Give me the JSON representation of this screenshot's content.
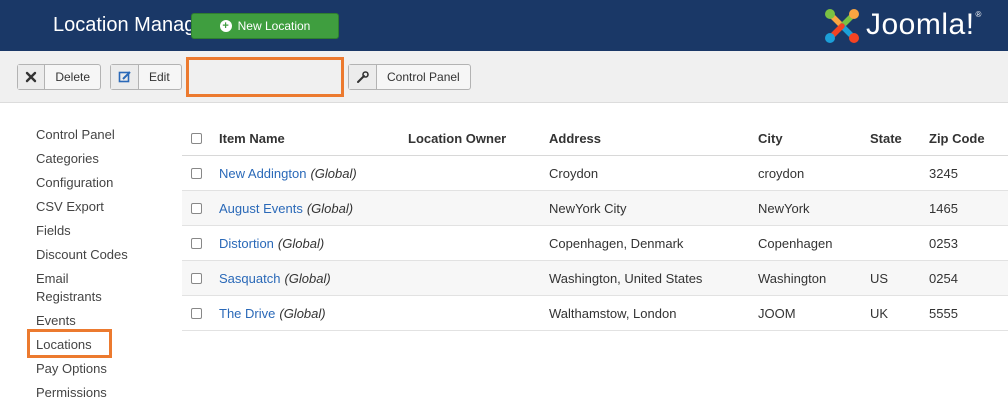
{
  "header": {
    "title": "Location Manager",
    "logo_text": "Joomla!",
    "logo_reg": "®"
  },
  "toolbar": {
    "delete_label": "Delete",
    "edit_label": "Edit",
    "new_label": "New Location",
    "control_panel_label": "Control Panel"
  },
  "sidebar": {
    "items": [
      {
        "label": "Control Panel"
      },
      {
        "label": "Categories"
      },
      {
        "label": "Configuration"
      },
      {
        "label": "CSV Export"
      },
      {
        "label": "Fields"
      },
      {
        "label": "Discount Codes"
      },
      {
        "label": "Email Registrants"
      },
      {
        "label": "Events"
      },
      {
        "label": "Locations"
      },
      {
        "label": "Pay Options"
      },
      {
        "label": "Permissions"
      }
    ]
  },
  "table": {
    "columns": [
      "Item Name",
      "Location Owner",
      "Address",
      "City",
      "State",
      "Zip Code"
    ],
    "rows": [
      {
        "name": "New Addington",
        "scope": "(Global)",
        "owner": "",
        "address": "Croydon",
        "city": "croydon",
        "state": "",
        "zip": "3245"
      },
      {
        "name": "August Events",
        "scope": "(Global)",
        "owner": "",
        "address": "NewYork City",
        "city": "NewYork",
        "state": "",
        "zip": "1465"
      },
      {
        "name": "Distortion",
        "scope": "(Global)",
        "owner": "",
        "address": "Copenhagen, Denmark",
        "city": "Copenhagen",
        "state": "",
        "zip": "0253"
      },
      {
        "name": "Sasquatch",
        "scope": "(Global)",
        "owner": "",
        "address": "Washington, United States",
        "city": "Washington",
        "state": "US",
        "zip": "0254"
      },
      {
        "name": "The Drive",
        "scope": "(Global)",
        "owner": "",
        "address": "Walthamstow, London",
        "city": "JOOM",
        "state": "UK",
        "zip": "5555"
      }
    ]
  },
  "colors": {
    "header_bg": "#1a3867",
    "new_button": "#3f9e3f",
    "highlight": "#ec7a2f",
    "link": "#2a69b8"
  },
  "icons": {
    "delete": "close-icon",
    "edit": "edit-icon",
    "new": "plus-circle-icon",
    "control_panel": "wrench-icon"
  }
}
